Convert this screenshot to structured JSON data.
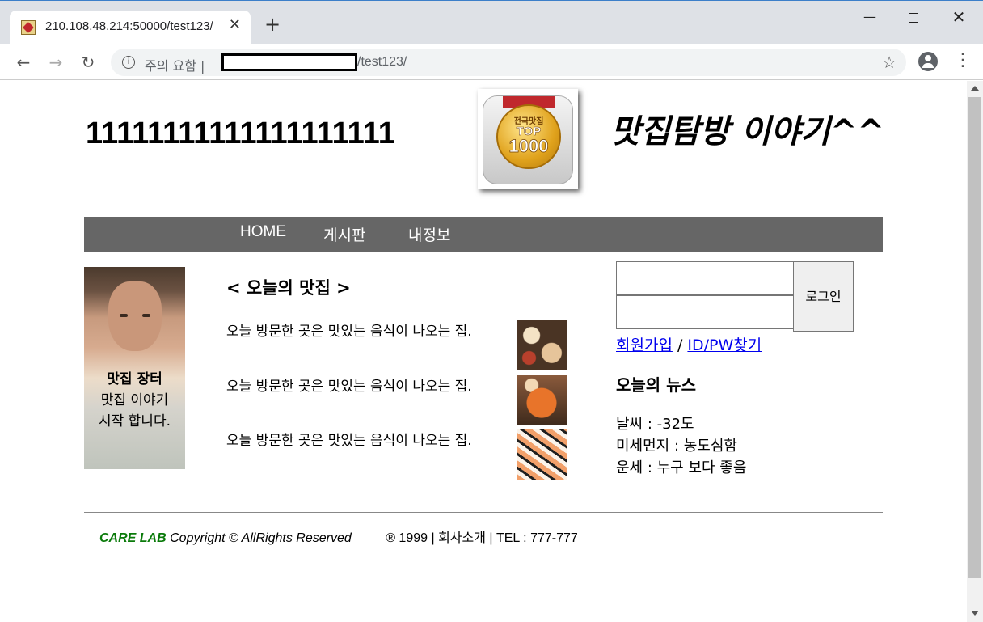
{
  "browser": {
    "tab_title": "210.108.48.214:50000/test123/",
    "tab_close": "✕",
    "new_tab": "+",
    "security_warning": "주의 요함 |",
    "url_path": "/test123/",
    "info_glyph": "i",
    "star_glyph": "☆",
    "menu_glyph": "⋮",
    "back_glyph": "←",
    "forward_glyph": "→",
    "reload_glyph": "↻",
    "min_glyph": "—",
    "close_glyph": "✕"
  },
  "header": {
    "logo": "11111111111111111111",
    "medal": {
      "line1": "전국맛집",
      "line2": "TOP",
      "line3": "1000"
    },
    "slogan": "맛집탐방 이야기^^"
  },
  "nav": {
    "items": [
      {
        "label": "HOME"
      },
      {
        "label": "게시판"
      },
      {
        "label": "내정보"
      }
    ]
  },
  "profile": {
    "title": "맛집 장터",
    "line1": "맛집 이야기",
    "line2": "시작 합니다."
  },
  "today": {
    "title": "< 오늘의 맛집 >",
    "items": [
      {
        "text": "오늘 방문한 곳은 맛있는 음식이 나오는 집."
      },
      {
        "text": "오늘 방문한 곳은 맛있는 음식이 나오는 집."
      },
      {
        "text": "오늘 방문한 곳은 맛있는 음식이 나오는 집."
      }
    ]
  },
  "login": {
    "id_value": "",
    "pw_value": "",
    "button": "로그인",
    "signup": "회원가입",
    "separator": " / ",
    "find": "ID/PW찾기"
  },
  "news": {
    "title": "오늘의 뉴스",
    "items": [
      {
        "text": "날씨 : -32도"
      },
      {
        "text": "미세먼지 : 농도심함"
      },
      {
        "text": "운세 : 누구 보다 좋음"
      }
    ]
  },
  "footer": {
    "brand": "CARE LAB",
    "copyright": " Copyright © AllRights Reserved",
    "info": "® 1999 | 회사소개 | TEL : 777-777"
  },
  "colors": {
    "nav_bg": "#666666",
    "link": "#0000ee",
    "brand_green": "#0a7a0a"
  }
}
